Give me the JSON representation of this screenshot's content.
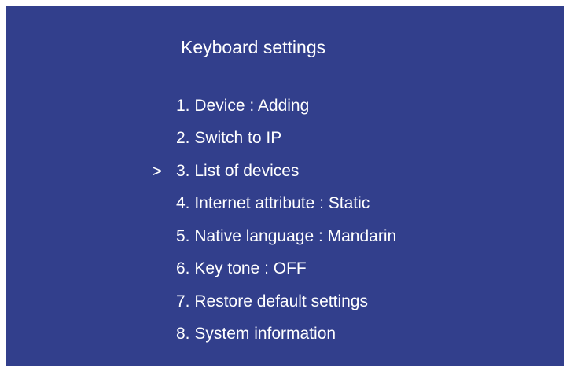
{
  "colors": {
    "screen_background": "#323f8c",
    "text": "#ffffff"
  },
  "title": "Keyboard settings",
  "cursor_symbol": ">",
  "selected_index": 2,
  "menu": {
    "items": [
      {
        "label": "1. Device : Adding"
      },
      {
        "label": "2. Switch to IP"
      },
      {
        "label": "3. List of devices"
      },
      {
        "label": "4. Internet attribute : Static"
      },
      {
        "label": "5. Native language : Mandarin"
      },
      {
        "label": "6. Key tone : OFF"
      },
      {
        "label": "7. Restore default settings"
      },
      {
        "label": "8. System information"
      }
    ]
  }
}
